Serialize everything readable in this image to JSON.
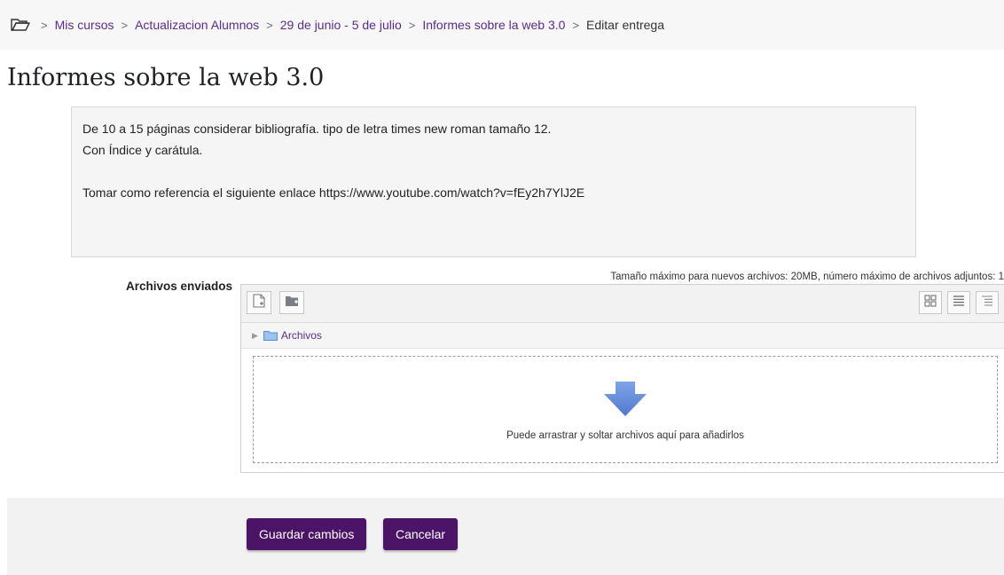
{
  "breadcrumb": {
    "items": [
      "Mis cursos",
      "Actualizacion Alumnos",
      "29 de junio - 5 de julio",
      "Informes sobre la web 3.0"
    ],
    "current": "Editar entrega",
    "separator": ">"
  },
  "page": {
    "title": "Informes sobre la web 3.0"
  },
  "intro": {
    "line1": "De 10 a 15 páginas considerar bibliografía. tipo de letra times new roman tamaño 12.",
    "line2": "Con Índice y carátula.",
    "line3": "Tomar como referencia el siguiente enlace https://www.youtube.com/watch?v=fEy2h7YlJ2E"
  },
  "files": {
    "label": "Archivos enviados",
    "limits": "Tamaño máximo para nuevos archivos: 20MB, número máximo de archivos adjuntos: 1",
    "path_folder": "Archivos",
    "drop_text": "Puede arrastrar y soltar archivos aquí para añadirlos"
  },
  "buttons": {
    "save": "Guardar cambios",
    "cancel": "Cancelar"
  },
  "colors": {
    "brand": "#4b1466",
    "link": "#5b2b8f",
    "drop_arrow": "#5b86d6"
  }
}
